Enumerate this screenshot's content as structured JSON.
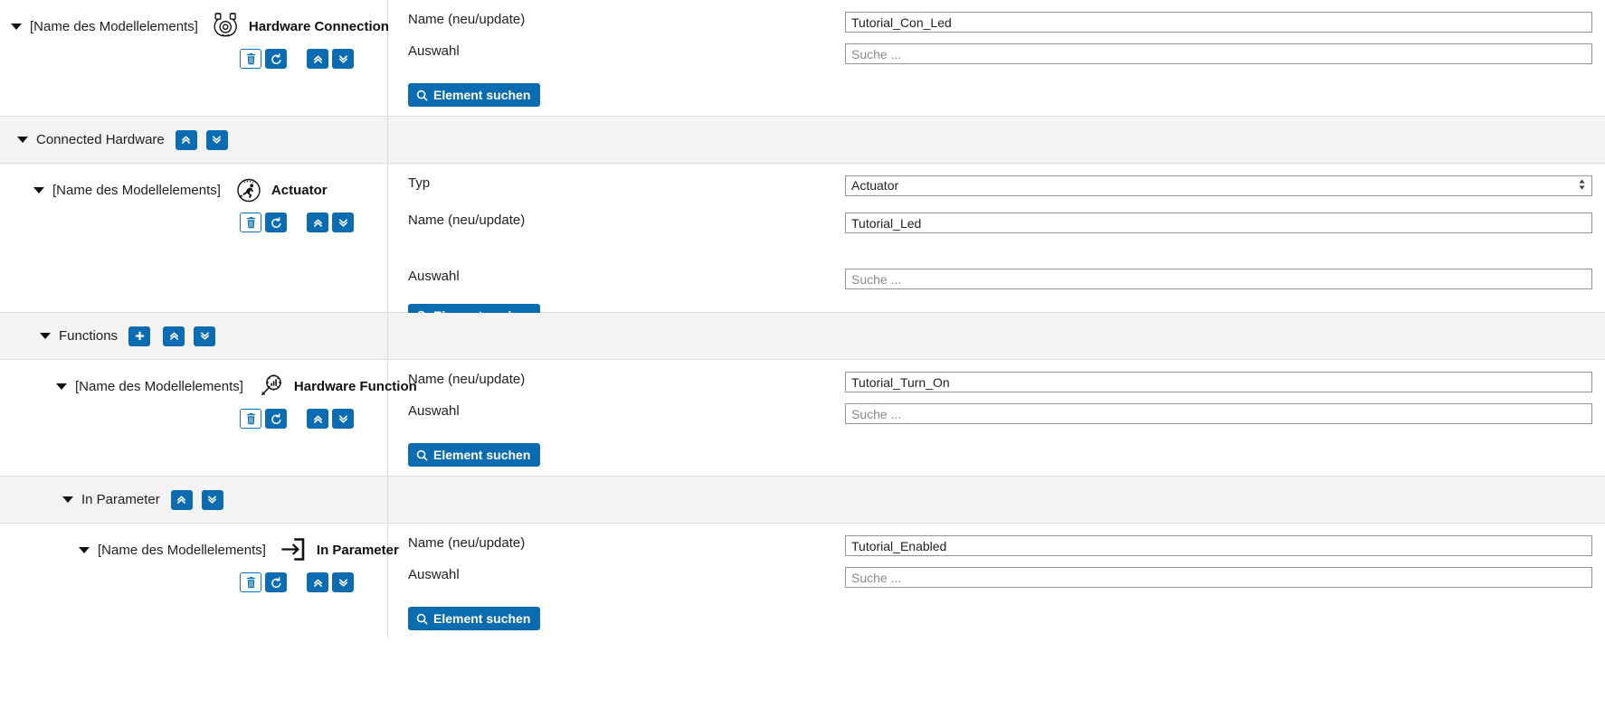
{
  "common": {
    "model_element_placeholder": "[Name des Modellelements]",
    "labels": {
      "typ": "Typ",
      "name": "Name (neu/update)",
      "auswahl": "Auswahl"
    },
    "search_placeholder": "Suche ...",
    "search_button": "Element suchen",
    "icons": {
      "caret": "caret-down-icon",
      "delete": "trash-icon",
      "reset": "undo-icon",
      "collapse": "chevron-double-up-icon",
      "expand": "chevron-double-down-icon",
      "add": "plus-icon",
      "search": "magnifier-icon",
      "select": "select-updown-icon"
    },
    "colors": {
      "accent": "#0b6cb1",
      "band_grey": "#f3f3f3",
      "border": "#dedede",
      "input_border": "#949494",
      "text": "#1a1a1a"
    }
  },
  "blocks": {
    "hardware_connection": {
      "model_name": "[Name des Modellelements]",
      "type_label": "Hardware Connection",
      "icon": "hardware-connection-icon",
      "fields": {
        "name_label": "Name (neu/update)",
        "name_value": "Tutorial_Con_Led",
        "auswahl_label": "Auswahl",
        "auswahl_placeholder": "Suche ...",
        "search_button": "Element suchen"
      },
      "actions": {
        "delete": "trash-icon",
        "reset": "undo-icon",
        "collapse": "chevron-double-up-icon",
        "expand": "chevron-double-down-icon"
      }
    },
    "connected_hardware_section": {
      "title": "Connected Hardware",
      "actions": {
        "collapse": "chevron-double-up-icon",
        "expand": "chevron-double-down-icon"
      }
    },
    "actuator": {
      "model_name": "[Name des Modellelements]",
      "type_label": "Actuator",
      "icon": "actuator-icon",
      "fields": {
        "typ_label": "Typ",
        "typ_value": "Actuator",
        "name_label": "Name (neu/update)",
        "name_value": "Tutorial_Led",
        "auswahl_label": "Auswahl",
        "auswahl_placeholder": "Suche ...",
        "search_button": "Element suchen"
      },
      "actions": {
        "delete": "trash-icon",
        "reset": "undo-icon",
        "collapse": "chevron-double-up-icon",
        "expand": "chevron-double-down-icon"
      }
    },
    "functions_section": {
      "title": "Functions",
      "actions": {
        "add": "plus-icon",
        "collapse": "chevron-double-up-icon",
        "expand": "chevron-double-down-icon"
      }
    },
    "hardware_function": {
      "model_name": "[Name des Modellelements]",
      "type_label": "Hardware Function",
      "icon": "hardware-function-icon",
      "fields": {
        "name_label": "Name (neu/update)",
        "name_value": "Tutorial_Turn_On",
        "auswahl_label": "Auswahl",
        "auswahl_placeholder": "Suche ...",
        "search_button": "Element suchen"
      },
      "actions": {
        "delete": "trash-icon",
        "reset": "undo-icon",
        "collapse": "chevron-double-up-icon",
        "expand": "chevron-double-down-icon"
      }
    },
    "in_parameter_section": {
      "title": "In Parameter",
      "actions": {
        "collapse": "chevron-double-up-icon",
        "expand": "chevron-double-down-icon"
      }
    },
    "in_parameter": {
      "model_name": "[Name des Modellelements]",
      "type_label": "In Parameter",
      "icon": "in-parameter-icon",
      "fields": {
        "name_label": "Name (neu/update)",
        "name_value": "Tutorial_Enabled",
        "auswahl_label": "Auswahl",
        "auswahl_placeholder": "Suche ...",
        "search_button": "Element suchen"
      },
      "actions": {
        "delete": "trash-icon",
        "reset": "undo-icon",
        "collapse": "chevron-double-up-icon",
        "expand": "chevron-double-down-icon"
      }
    }
  }
}
